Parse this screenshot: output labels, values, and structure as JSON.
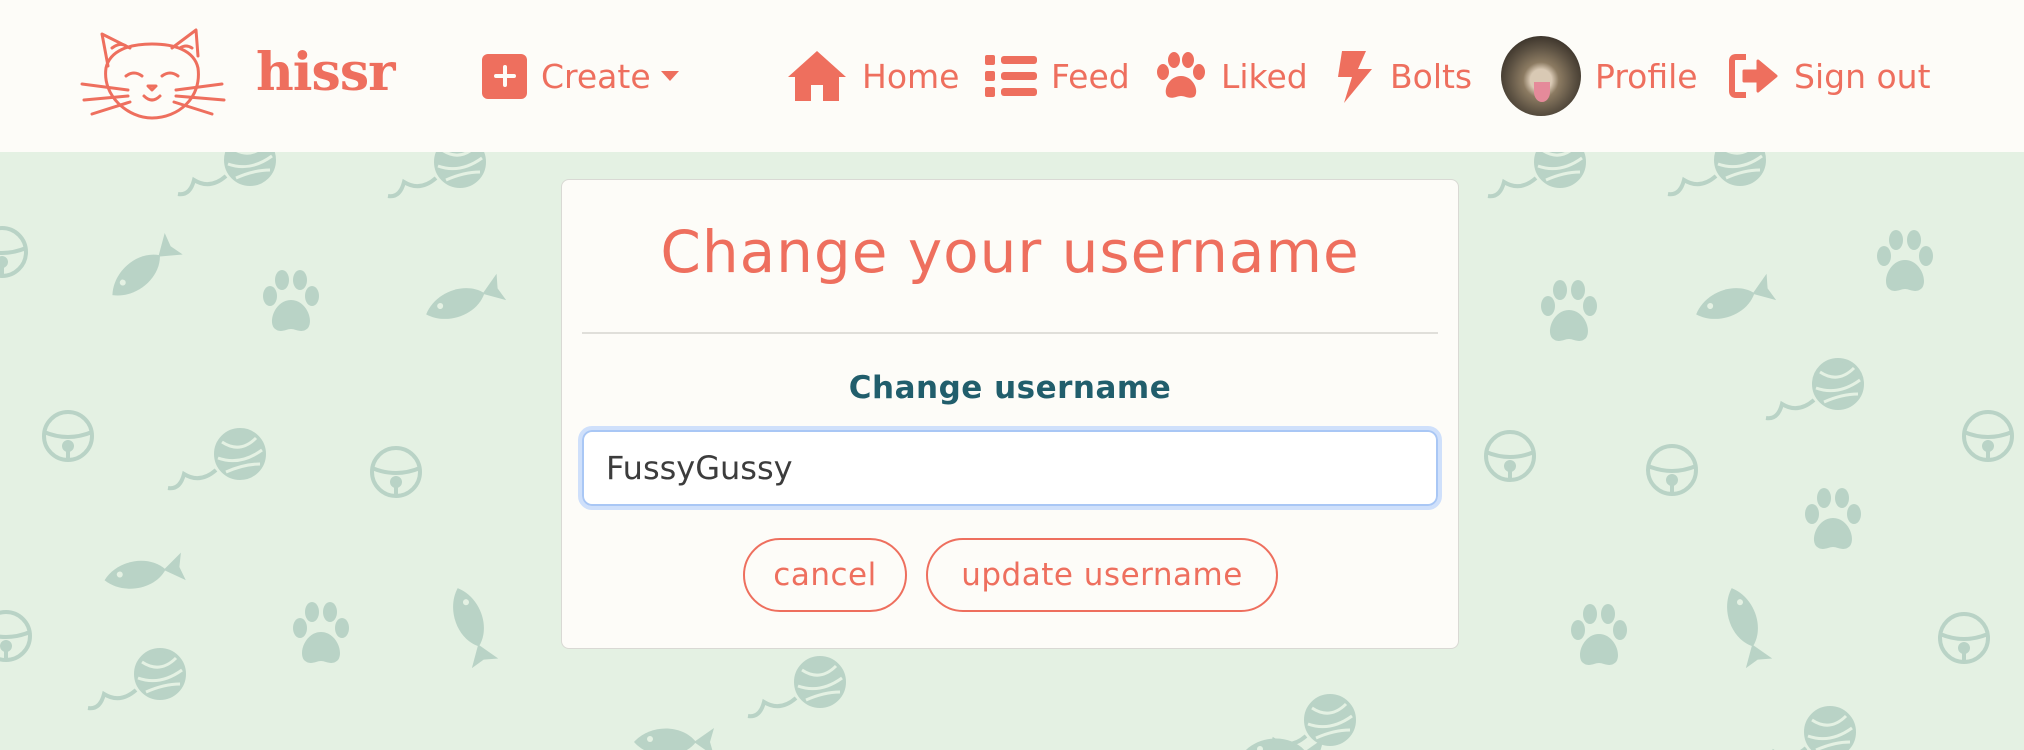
{
  "brand": {
    "name": "hissr",
    "logo_icon": "cat-face-icon"
  },
  "nav": {
    "create": {
      "label": "Create",
      "icon": "plus-square-icon"
    },
    "home": {
      "label": "Home",
      "icon": "house-icon"
    },
    "feed": {
      "label": "Feed",
      "icon": "list-icon"
    },
    "liked": {
      "label": "Liked",
      "icon": "paw-icon"
    },
    "bolts": {
      "label": "Bolts",
      "icon": "bolt-icon"
    },
    "profile": {
      "label": "Profile",
      "icon": "avatar"
    },
    "signout": {
      "label": "Sign out",
      "icon": "sign-out-icon"
    }
  },
  "form": {
    "title": "Change your username",
    "field_label": "Change username",
    "username_value": "FussyGussy",
    "cancel_label": "cancel",
    "submit_label": "update username"
  },
  "colors": {
    "accent": "#ee6f5e",
    "label": "#215e6c",
    "navbar_bg": "#fdfcf8",
    "page_bg": "#e4f1e3",
    "pattern": "#b9d3c6"
  }
}
